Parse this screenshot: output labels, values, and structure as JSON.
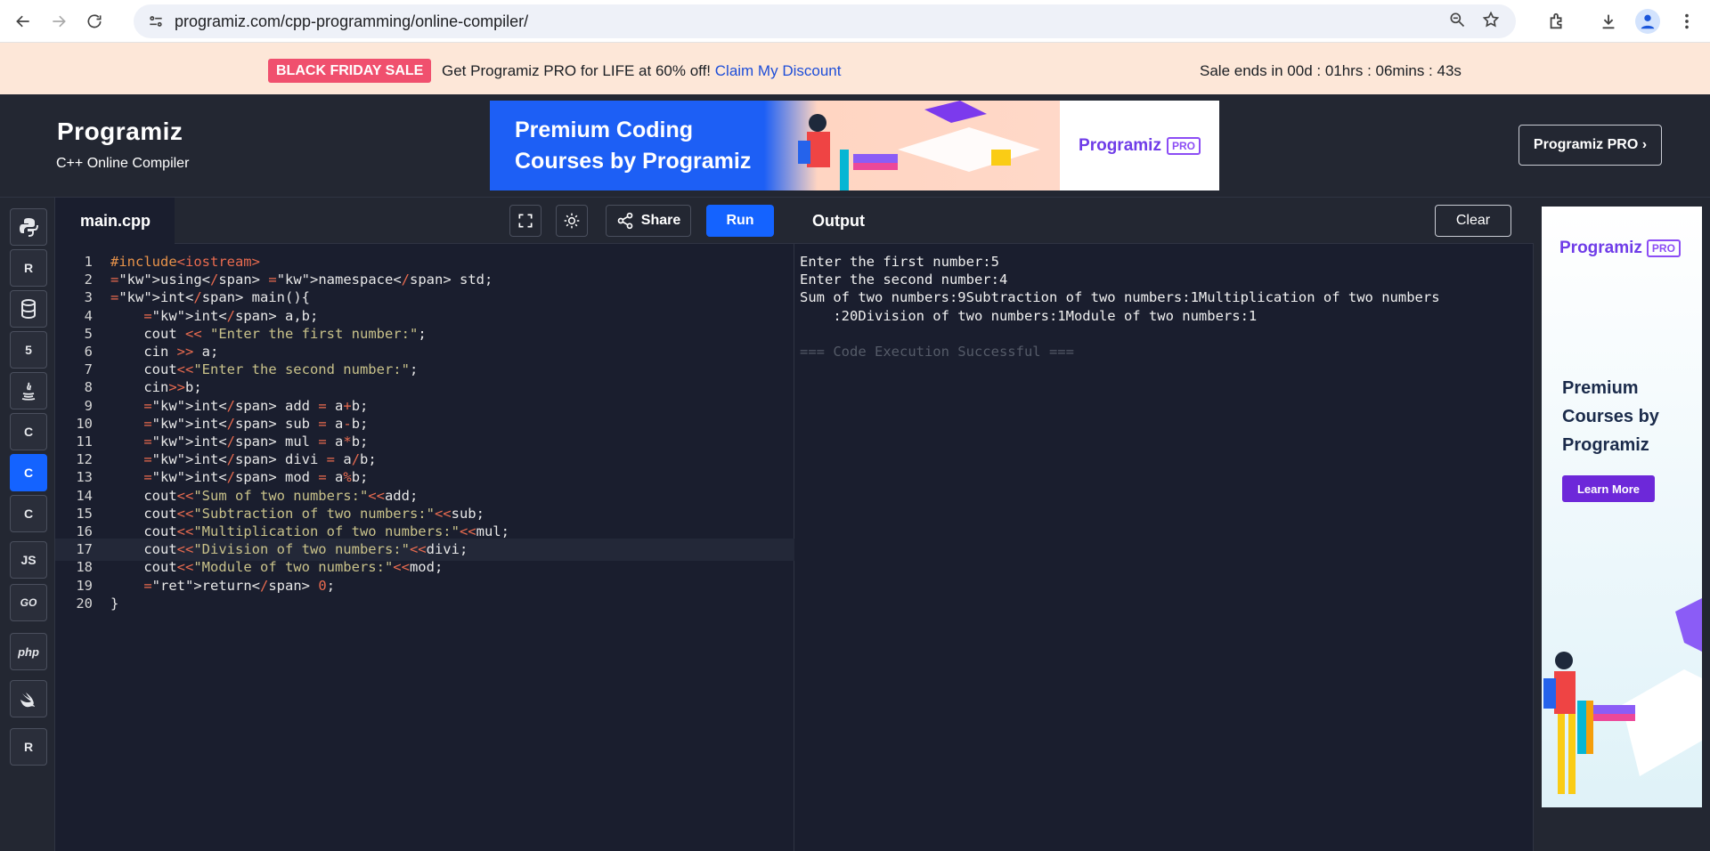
{
  "browser": {
    "url": "programiz.com/cpp-programming/online-compiler/"
  },
  "sale": {
    "badge": "BLACK FRIDAY SALE",
    "text": "Get Programiz PRO for LIFE at 60% off!",
    "link": "Claim My Discount",
    "ends": "Sale ends in 00d : 01hrs : 06mins : 43s"
  },
  "header": {
    "logo": "Programiz",
    "subtitle": "C++ Online Compiler",
    "banner_line1": "Premium Coding",
    "banner_line2": "Courses by Programiz",
    "banner_logo": "Programiz",
    "banner_pro": "PRO",
    "pro_button": "Programiz PRO ›"
  },
  "languages": [
    {
      "name": "python",
      "label": ""
    },
    {
      "name": "r",
      "label": "R"
    },
    {
      "name": "sql",
      "label": ""
    },
    {
      "name": "html",
      "label": "5"
    },
    {
      "name": "java",
      "label": ""
    },
    {
      "name": "c",
      "label": "C"
    },
    {
      "name": "cpp",
      "label": "C"
    },
    {
      "name": "csharp",
      "label": "C"
    },
    {
      "name": "javascript",
      "label": "JS"
    },
    {
      "name": "go",
      "label": "GO"
    },
    {
      "name": "php",
      "label": "php"
    },
    {
      "name": "swift",
      "label": ""
    },
    {
      "name": "rust",
      "label": "R"
    }
  ],
  "editor": {
    "file_name": "main.cpp",
    "share_label": "Share",
    "run_label": "Run",
    "highlighted_line": 17,
    "lines": [
      "#include<iostream>",
      "using namespace std;",
      "int main(){",
      "    int a,b;",
      "    cout << \"Enter the first number:\";",
      "    cin >> a;",
      "    cout<<\"Enter the second number:\";",
      "    cin>>b;",
      "    int add = a+b;",
      "    int sub = a-b;",
      "    int mul = a*b;",
      "    int divi = a/b;",
      "    int mod = a%b;",
      "    cout<<\"Sum of two numbers:\"<<add;",
      "    cout<<\"Subtraction of two numbers:\"<<sub;",
      "    cout<<\"Multiplication of two numbers:\"<<mul;",
      "    cout<<\"Division of two numbers:\"<<divi;",
      "    cout<<\"Module of two numbers:\"<<mod;",
      "    return 0;",
      "}"
    ]
  },
  "output": {
    "title": "Output",
    "clear_label": "Clear",
    "lines": [
      "Enter the first number:5",
      "Enter the second number:4",
      "Sum of two numbers:9Subtraction of two numbers:1Multiplication of two numbers",
      "    :20Division of two numbers:1Module of two numbers:1",
      "",
      "=== Code Execution Successful ==="
    ]
  },
  "right_ad": {
    "logo": "Programiz",
    "pro": "PRO",
    "line1": "Premium",
    "line2": "Courses by",
    "line3": "Programiz",
    "button": "Learn More"
  }
}
